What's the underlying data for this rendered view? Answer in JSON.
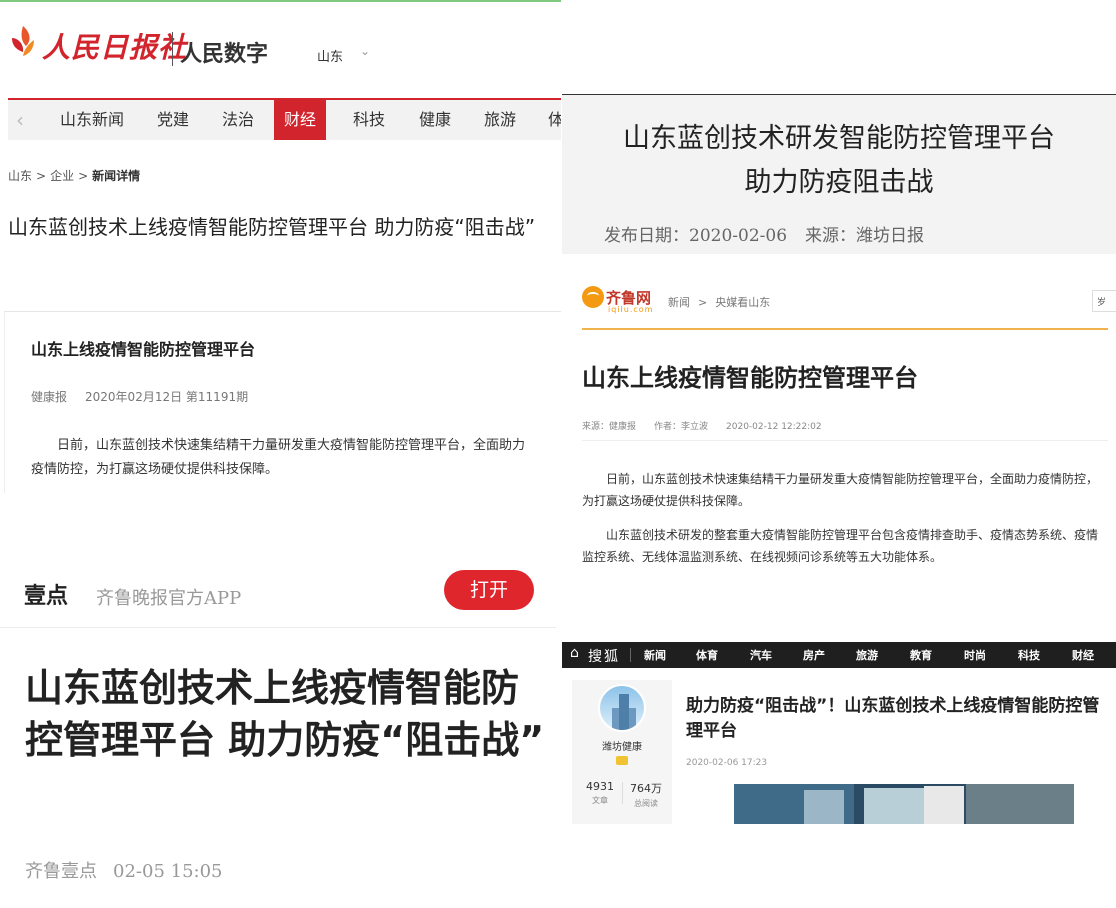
{
  "people_daily": {
    "logo_text": "人民日报社",
    "brand": "人民数字",
    "region": "山东",
    "region_caret": "⌄",
    "nav_prev": "‹",
    "nav": [
      "山东新闻",
      "党建",
      "法治",
      "财经",
      "科技",
      "健康",
      "旅游",
      "体"
    ],
    "nav_active": "财经",
    "breadcrumb": [
      "山东",
      "企业",
      "新闻详情"
    ],
    "breadcrumb_sep": ">",
    "headline": "山东蓝创技术上线疫情智能防控管理平台 助力防疫“阻击战”",
    "sub_title": "山东上线疫情智能防控管理平台",
    "sub_source": "健康报",
    "sub_date": "2020年02月12日 第11191期",
    "sub_body": "日前，山东蓝创技术快速集结精干力量研发重大疫情智能防控管理平台，全面助力疫情防控，为打赢这场硬仗提供科技保障。"
  },
  "weifang_daily": {
    "title_line1": "山东蓝创技术研发智能防控管理平台",
    "title_line2": "助力防疫阻击战",
    "date": "发布日期：2020-02-06",
    "source": "来源：潍坊日报"
  },
  "qilu_net": {
    "logo_name": "齐鲁网",
    "logo_sub": "iqilu.com",
    "crumb": [
      "新闻",
      "央媒看山东"
    ],
    "crumb_sep": ">",
    "search_stub": "岁",
    "title": "山东上线疫情智能防控管理平台",
    "source": "来源：健康报",
    "author": "作者：李立波",
    "datetime": "2020-02-12 12:22:02",
    "p1": "日前，山东蓝创技术快速集结精干力量研发重大疫情智能防控管理平台，全面助力疫情防控，为打赢这场硬仗提供科技保障。",
    "p2": "山东蓝创技术研发的整套重大疫情智能防控管理平台包含疫情排查助手、疫情态势系统、疫情监控系统、无线体温监测系统、在线视频问诊系统等五大功能体系。"
  },
  "qilu_app": {
    "logo_text": "壹点",
    "app_name": "齐鲁晚报官方APP",
    "open_label": "打开",
    "title": "山东蓝创技术上线疫情智能防控管理平台 助力防疫“阻击战”",
    "source": "齐鲁壹点",
    "time": "02-05 15:05"
  },
  "sohu": {
    "home_icon": "⌂",
    "brand": "搜狐",
    "nav": [
      "新闻",
      "体育",
      "汽车",
      "房产",
      "旅游",
      "教育",
      "时尚",
      "科技",
      "财经"
    ],
    "author_name": "潍坊健康",
    "articles_count": "4931",
    "articles_label": "文章",
    "reads_count": "764万",
    "reads_label": "总阅读",
    "title": "助力防疫“阻击战”！山东蓝创技术上线疫情智能防控管理平台",
    "date": "2020-02-06 17:23"
  },
  "colors": {
    "people_red": "#d2242c",
    "qilu_orange": "#f39a12",
    "open_button_red": "#e0262d",
    "sohu_bar": "#1f1f1f"
  }
}
